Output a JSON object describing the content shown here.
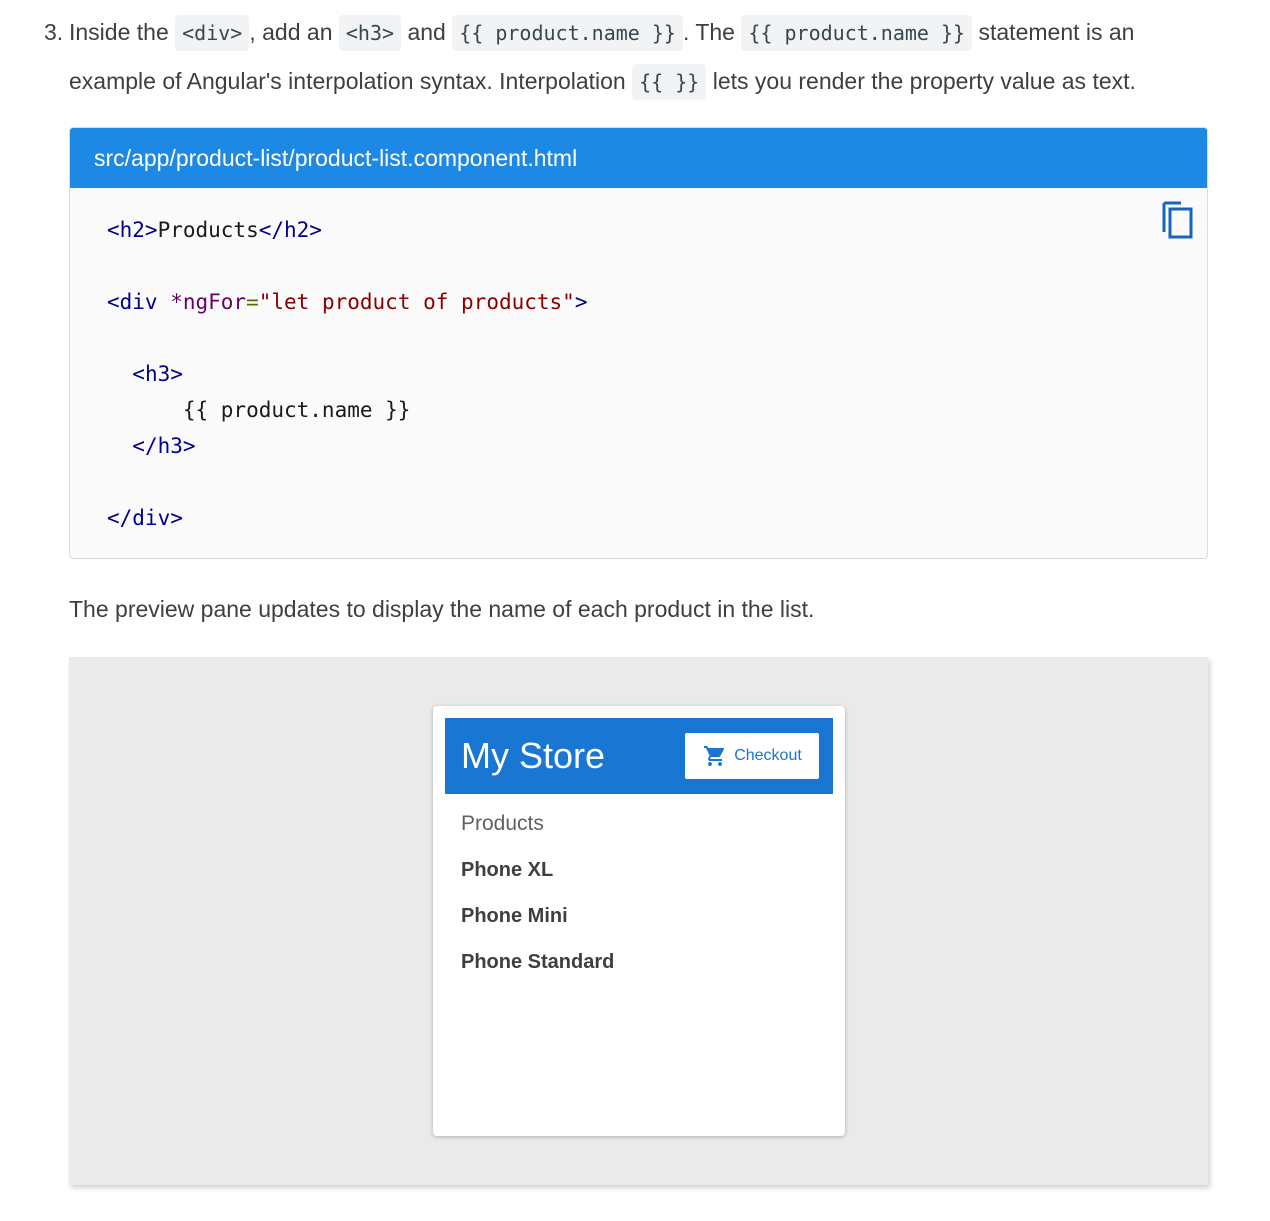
{
  "step": {
    "number": "3.",
    "t1": "Inside the",
    "c1": "<div>",
    "t2": ", add an",
    "c2": "<h3>",
    "t3": "and",
    "c3": "{{ product.name }}",
    "t4": ". The",
    "c4": "{{ product.name }}",
    "t5": "statement is an",
    "t6": "example of Angular's interpolation syntax. Interpolation",
    "c5": "{{ }}",
    "t7": "lets you render the property value as text."
  },
  "code_panel": {
    "filename": "src/app/product-list/product-list.component.html",
    "copy_icon": "copy-icon",
    "tokens": {
      "h2_open": "<h2>",
      "h2_text": "Products",
      "h2_close": "</h2>",
      "div_open_start": "<div",
      "ngfor_attr": " *ngFor",
      "equals": "=",
      "ngfor_value": "\"let product of products\"",
      "div_open_end": ">",
      "h3_open": "<h3>",
      "interp": "{{ product.name }}",
      "h3_close": "</h3>",
      "div_close": "</div>"
    }
  },
  "description": "The preview pane updates to display the name of each product in the list.",
  "preview": {
    "app_title": "My Store",
    "checkout_label": "Checkout",
    "checkout_icon": "cart-icon",
    "products_heading": "Products",
    "products": [
      "Phone XL",
      "Phone Mini",
      "Phone Standard"
    ]
  },
  "colors": {
    "code_header": "#1e88e5",
    "app_bar": "#1976d2",
    "preview_background": "#eaeaea"
  }
}
